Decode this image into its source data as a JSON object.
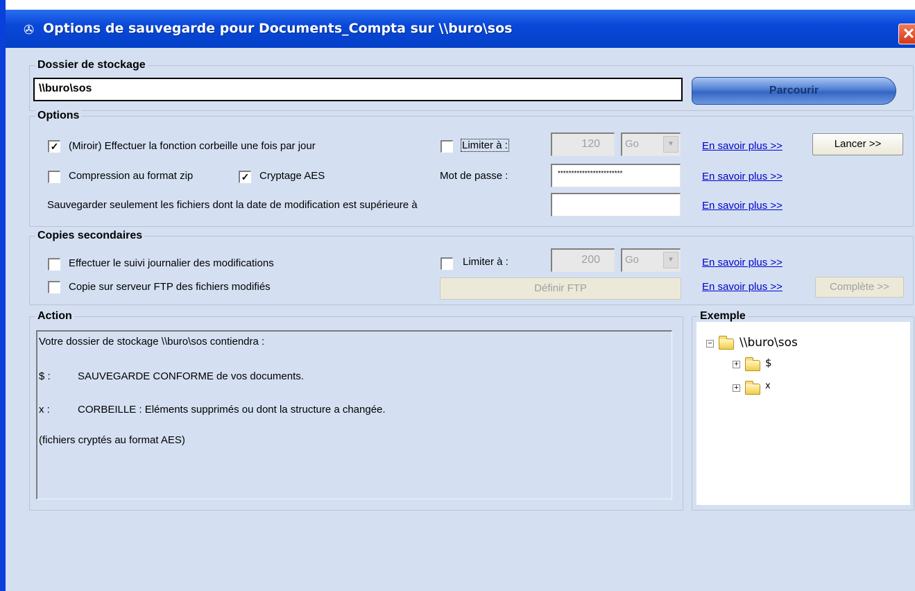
{
  "window": {
    "title": "Options de sauvegarde pour Documents_Compta  sur  \\\\buro\\sos",
    "close_glyph": "✕",
    "title_icon": "app-icon"
  },
  "storage": {
    "legend": "Dossier de stockage",
    "path_value": "\\\\buro\\sos",
    "browse_label": "Parcourir"
  },
  "options": {
    "legend": "Options",
    "mirror_label": "(Miroir) Effectuer la fonction corbeille une fois par jour",
    "mirror_checked": true,
    "limit_label": "Limiter à :",
    "limit_checked": false,
    "limit_value": "120",
    "limit_unit": "Go",
    "learn_more_1": "En savoir plus >>",
    "launch_label": "Lancer >>",
    "zip_label": "Compression au format zip",
    "zip_checked": false,
    "aes_label": "Cryptage AES",
    "aes_checked": true,
    "password_label": "Mot de passe :",
    "password_value": "************************",
    "learn_more_2": "En savoir plus >>",
    "date_label": "Sauvegarder seulement les fichiers dont la date de modification est supérieure à",
    "date_value": "",
    "learn_more_3": "En savoir plus >>"
  },
  "secondary": {
    "legend": "Copies secondaires",
    "journal_label": "Effectuer le suivi journalier des modifications",
    "journal_checked": false,
    "limit_label": "Limiter à :",
    "limit_checked": false,
    "limit_value": "200",
    "limit_unit": "Go",
    "learn_more_1": "En savoir plus >>",
    "ftp_label": "Copie sur serveur  FTP des fichiers modifiés",
    "ftp_checked": false,
    "define_ftp_label": "Définir FTP",
    "learn_more_2": "En savoir plus >>",
    "complete_label": "Complète >>"
  },
  "action": {
    "legend": "Action",
    "line1": "Votre dossier de stockage \\\\buro\\sos contiendra :",
    "line2_key": "$ :",
    "line2_text": "SAUVEGARDE CONFORME de vos documents.",
    "line3_key": "x :",
    "line3_text": "CORBEILLE : Eléments supprimés ou dont la structure a changée.",
    "line4": "(fichiers cryptés au format AES)"
  },
  "example": {
    "legend": "Exemple",
    "root": "\\\\buro\\sos",
    "children": [
      "$",
      "x"
    ]
  },
  "colors": {
    "titlebar": "#0a48d8",
    "window_bg": "#d4e0f2",
    "link": "#0000cc",
    "close": "#d4381a"
  }
}
